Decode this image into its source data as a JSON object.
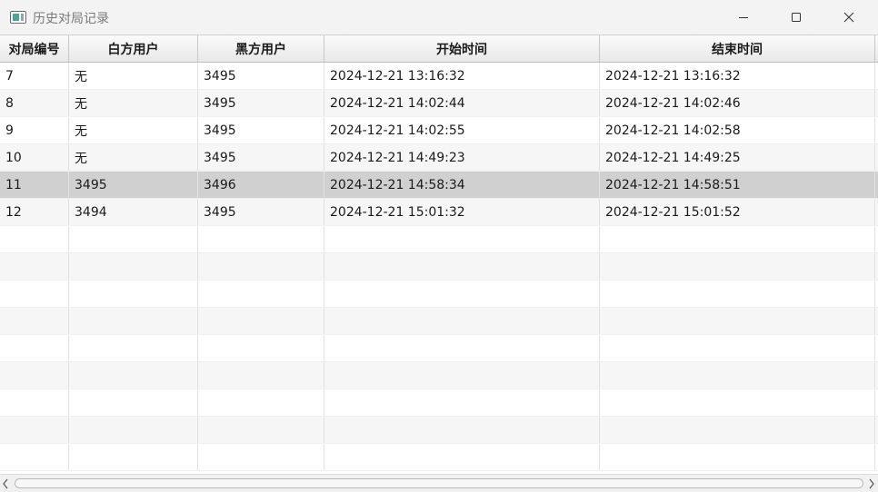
{
  "window": {
    "title": "历史对局记录",
    "icon": "app-window-icon",
    "controls": [
      "minimize-icon",
      "maximize-icon",
      "close-icon"
    ]
  },
  "table": {
    "columns": [
      "对局编号",
      "白方用户",
      "黑方用户",
      "开始时间",
      "结束时间"
    ],
    "rows": [
      [
        "7",
        "无",
        "3495",
        "2024-12-21 13:16:32",
        "2024-12-21 13:16:32"
      ],
      [
        "8",
        "无",
        "3495",
        "2024-12-21 14:02:44",
        "2024-12-21 14:02:46"
      ],
      [
        "9",
        "无",
        "3495",
        "2024-12-21 14:02:55",
        "2024-12-21 14:02:58"
      ],
      [
        "10",
        "无",
        "3495",
        "2024-12-21 14:49:23",
        "2024-12-21 14:49:25"
      ],
      [
        "11",
        "3495",
        "3496",
        "2024-12-21 14:58:34",
        "2024-12-21 14:58:51"
      ],
      [
        "12",
        "3494",
        "3495",
        "2024-12-21 15:01:32",
        "2024-12-21 15:01:52"
      ]
    ],
    "selected_row_index": 4,
    "empty_row_count": 9
  },
  "colors": {
    "selected_row": "#d0d0d0",
    "alt_row": "#f6f6f6",
    "title_bar": "#f3f3f3"
  }
}
